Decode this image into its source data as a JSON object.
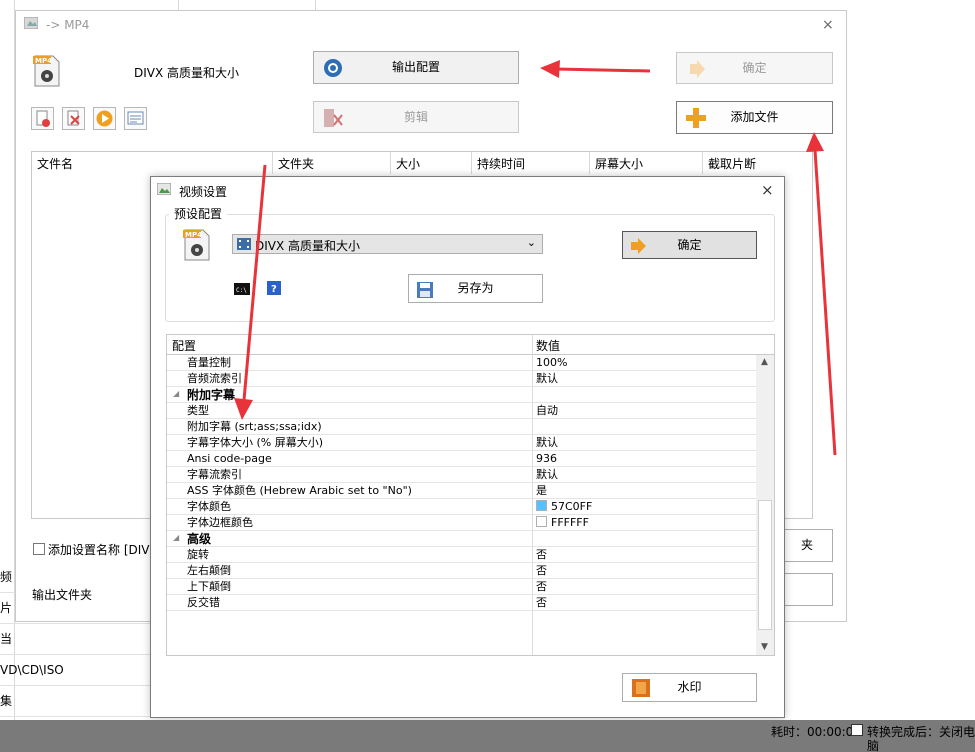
{
  "background": {
    "left_items": [
      "频",
      "片",
      "当",
      "VD\\CD\\ISO",
      "集"
    ],
    "status_time": "耗时：00:00:00",
    "status_after": "转换完成后：关闭电脑"
  },
  "outer_dialog": {
    "title": "-> MP4",
    "preset_name": "DIVX 高质量和大小",
    "output_config_button": "输出配置",
    "ok_button": "确定",
    "edit_button": "剪辑",
    "add_file_button": "添加文件",
    "columns": [
      "文件名",
      "文件夹",
      "大小",
      "持续时间",
      "屏幕大小",
      "截取片断"
    ],
    "add_setting_name_label": "添加设置名称 [DIV",
    "output_folder_label": "输出文件夹",
    "right_button_partial": "夹"
  },
  "video_dialog": {
    "title": "视频设置",
    "group_title": "预设配置",
    "preset_value": "DIVX 高质量和大小",
    "ok_button": "确定",
    "save_as_button": "另存为",
    "watermark_button": "水印",
    "grid_headers": {
      "name": "配置",
      "value": "数值"
    },
    "rows": [
      {
        "type": "item",
        "name": "音量控制",
        "value": "100%"
      },
      {
        "type": "item",
        "name": "音频流索引",
        "value": "默认"
      },
      {
        "type": "category",
        "name": "附加字幕",
        "value": ""
      },
      {
        "type": "item",
        "name": "类型",
        "value": "自动"
      },
      {
        "type": "item",
        "name": "附加字幕 (srt;ass;ssa;idx)",
        "value": ""
      },
      {
        "type": "item",
        "name": "字幕字体大小 (% 屏幕大小)",
        "value": "默认"
      },
      {
        "type": "item",
        "name": "Ansi code-page",
        "value": "936"
      },
      {
        "type": "item",
        "name": "字幕流索引",
        "value": "默认"
      },
      {
        "type": "item",
        "name": "ASS 字体颜色 (Hebrew Arabic set to \"No\")",
        "value": "是"
      },
      {
        "type": "color",
        "name": "字体颜色",
        "value": "57C0FF",
        "swatch": "#57C0FF"
      },
      {
        "type": "color",
        "name": "字体边框颜色",
        "value": "FFFFFF",
        "swatch": "#FFFFFF"
      },
      {
        "type": "category",
        "name": "高级",
        "value": ""
      },
      {
        "type": "item",
        "name": "旋转",
        "value": "否"
      },
      {
        "type": "item",
        "name": "左右颠倒",
        "value": "否"
      },
      {
        "type": "item",
        "name": "上下颠倒",
        "value": "否"
      },
      {
        "type": "item",
        "name": "反交错",
        "value": "否"
      }
    ]
  },
  "icons": {
    "mp4_file": "mp4-file-icon",
    "output_config": "gear-icon",
    "ok": "arrow-right-icon",
    "edit": "film-scissors-icon",
    "add": "plus-icon",
    "save": "floppy-disk-icon",
    "cmd": "cmd-icon",
    "help": "help-icon",
    "watermark": "watermark-icon"
  },
  "colors": {
    "accent_arrow": "#E8333B",
    "add_plus": "#F0A020"
  }
}
